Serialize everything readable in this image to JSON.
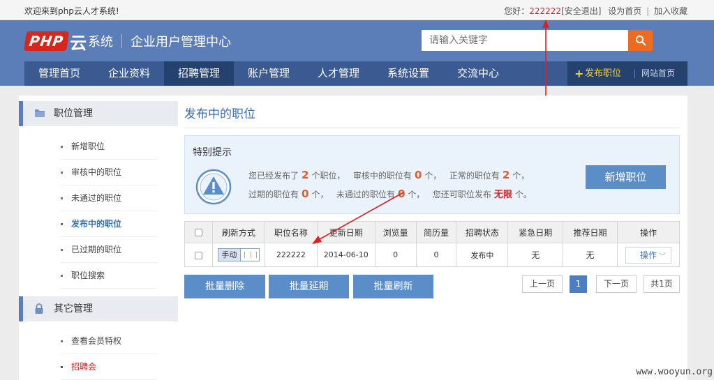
{
  "topbar": {
    "welcome": "欢迎来到php云人才系统!",
    "greeting": "您好：",
    "username": "222222",
    "logout": "[安全退出]",
    "set_home": "设为首页",
    "bookmark": "加入收藏"
  },
  "header": {
    "logo_php": "PHP",
    "logo_yun": "云",
    "logo_system": "系统",
    "subtitle": "企业用户管理中心",
    "search_placeholder": "请输入关键字",
    "search_icon": "search-icon"
  },
  "nav": {
    "items": [
      "管理首页",
      "企业资料",
      "招聘管理",
      "账户管理",
      "人才管理",
      "系统设置",
      "交流中心"
    ],
    "active_index": 2,
    "publish_label": "发布职位",
    "site_home": "网站首页"
  },
  "sidebar": {
    "groups": [
      {
        "title": "职位管理",
        "icon": "folder-icon",
        "items": [
          "新增职位",
          "审核中的职位",
          "未通过的职位",
          "发布中的职位",
          "已过期的职位",
          "职位搜索"
        ],
        "active_index": 3
      },
      {
        "title": "其它管理",
        "icon": "lock-icon",
        "items": [
          "查看会员特权",
          "招聘会"
        ],
        "highlight_index": 1
      }
    ]
  },
  "main": {
    "title": "发布中的职位",
    "tip": {
      "title": "特别提示",
      "l1_a": "您已经发布了",
      "published": "2",
      "l1_b": "个职位，",
      "l1_c": "审核中的职位有",
      "reviewing": "0",
      "l1_d": "个，",
      "l1_e": "正常的职位有",
      "normal": "2",
      "l1_f": "个，",
      "l2_a": "过期的职位有",
      "expired": "0",
      "l2_b": "个，",
      "l2_c": "未通过的职位有",
      "rejected": "0",
      "l2_d": "个，",
      "l2_e": "您还可职位发布",
      "remaining": "无限",
      "l2_f": "个。",
      "add_button": "新增职位"
    },
    "table": {
      "headers": [
        "",
        "刷新方式",
        "职位名称",
        "更新日期",
        "浏览量",
        "简历量",
        "招聘状态",
        "紧急日期",
        "推荐日期",
        "操作"
      ],
      "rows": [
        {
          "refresh": "手动",
          "name": "222222",
          "date": "2014-06-10",
          "views": "0",
          "resumes": "0",
          "status": "发布中",
          "urgent": "无",
          "recommend": "无",
          "op": "操作"
        }
      ]
    },
    "bulk": {
      "delete": "批量删除",
      "extend": "批量延期",
      "refresh": "批量刷新"
    },
    "pager": {
      "prev": "上一页",
      "current": "1",
      "next": "下一页",
      "total": "共1页"
    }
  },
  "colors": {
    "header_bg": "#5b7db8",
    "nav_bg": "#3a5a91",
    "nav_active": "#25416e",
    "accent": "#ec6a22",
    "button": "#5b8dc9",
    "annotation": "#e02020"
  },
  "watermark": "www.wooyun.org"
}
